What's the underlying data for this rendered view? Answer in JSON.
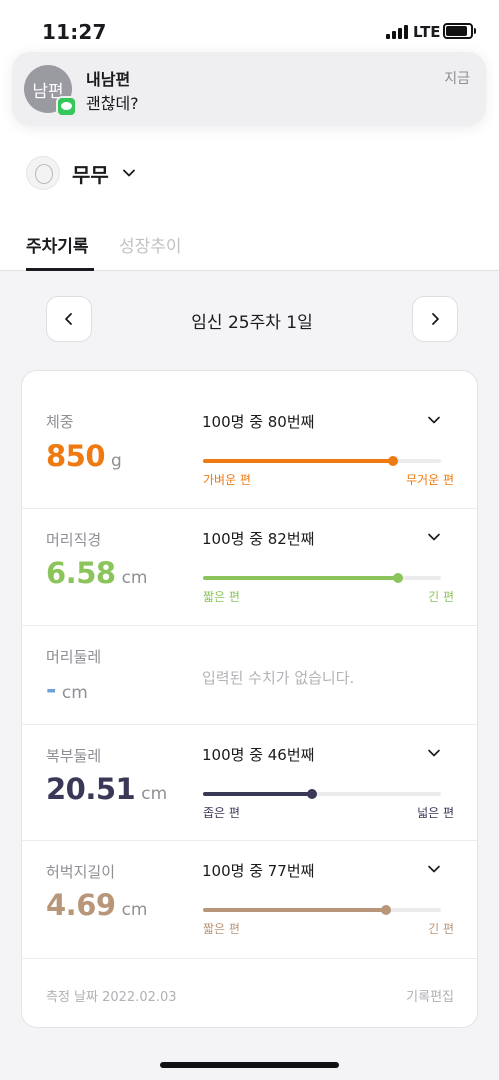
{
  "status_bar": {
    "time": "11:27",
    "network": "LTE"
  },
  "notification": {
    "avatar_text": "남편",
    "title": "내남편",
    "message": "괜찮데?",
    "time": "지금",
    "app_icon": "messages-icon"
  },
  "profile": {
    "name": "무무"
  },
  "tabs": [
    {
      "label": "주차기록",
      "active": true
    },
    {
      "label": "성장추이",
      "active": false
    }
  ],
  "date_nav": {
    "label": "임신 25주차 1일"
  },
  "metrics": [
    {
      "label": "체중",
      "value": "850",
      "unit": "g",
      "rank": "100명 중 80번째",
      "percent": 0.8,
      "color": "#ef7a12",
      "low_label": "가벼운 편",
      "high_label": "무거운 편"
    },
    {
      "label": "머리직경",
      "value": "6.58",
      "unit": "cm",
      "rank": "100명 중 82번째",
      "percent": 0.82,
      "color": "#8cc45c",
      "low_label": "짧은 편",
      "high_label": "긴 편"
    },
    {
      "label": "머리둘레",
      "value": "-",
      "unit": "cm",
      "color": "#6fa0d8",
      "empty_message": "입력된 수치가 없습니다."
    },
    {
      "label": "복부둘레",
      "value": "20.51",
      "unit": "cm",
      "rank": "100명 중 46번째",
      "percent": 0.46,
      "color": "#3a3857",
      "low_label": "좁은 편",
      "high_label": "넓은 편"
    },
    {
      "label": "허벅지길이",
      "value": "4.69",
      "unit": "cm",
      "rank": "100명 중 77번째",
      "percent": 0.77,
      "color": "#b8967a",
      "low_label": "짧은 편",
      "high_label": "긴 편"
    }
  ],
  "footer": {
    "measure_date": "측정 날짜 2022.02.03",
    "edit_label": "기록편집"
  }
}
